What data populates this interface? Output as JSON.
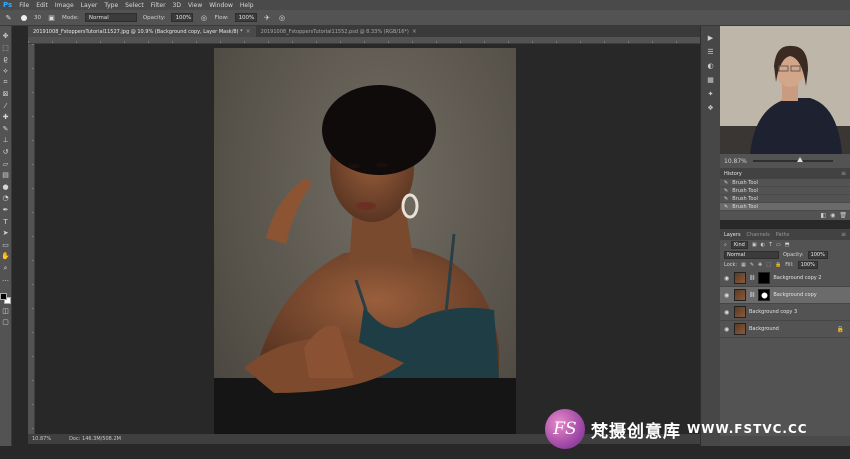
{
  "menubar": {
    "logo": "Ps",
    "items": [
      "File",
      "Edit",
      "Image",
      "Layer",
      "Type",
      "Select",
      "Filter",
      "3D",
      "View",
      "Window",
      "Help"
    ]
  },
  "options": {
    "brush_size": "30",
    "mode_label": "Mode:",
    "mode_value": "Normal",
    "opacity_label": "Opacity:",
    "opacity_value": "100%",
    "flow_label": "Flow:",
    "flow_value": "100%"
  },
  "tabs": [
    {
      "label": "20191008_FstoppersTutorial11527.jpg @ 10.9% (Background copy, Layer Mask/8) *",
      "active": true
    },
    {
      "label": "20191008_FstoppersTutorial11552.psd @ 8.33% (RGB/16*)",
      "active": false
    }
  ],
  "status": {
    "zoom": "10.87%",
    "doc": "Doc: 146.3M/508.2M"
  },
  "navigator": {
    "zoom": "10.87%"
  },
  "history": {
    "title": "History",
    "items": [
      "Brush Tool",
      "Brush Tool",
      "Brush Tool",
      "Brush Tool"
    ]
  },
  "layers_panel": {
    "tabs": [
      "Layers",
      "Channels",
      "Paths"
    ],
    "kind_label": "Kind",
    "blend_mode": "Normal",
    "opacity_label": "Opacity:",
    "opacity_value": "100%",
    "lock_label": "Lock:",
    "fill_label": "Fill:",
    "fill_value": "100%",
    "layers": [
      {
        "name": "Background copy 2",
        "selected": false
      },
      {
        "name": "Background copy",
        "selected": true
      },
      {
        "name": "Background copy 3",
        "selected": false
      },
      {
        "name": "Background",
        "selected": false
      }
    ]
  },
  "watermark": {
    "logo_text": "FS",
    "brand": "梵摄创意库",
    "url": "WWW.FSTVC.CC"
  },
  "colors": {
    "ps_blue": "#31a8ff",
    "panel_bg": "#535353",
    "canvas_bg": "#282828",
    "foreground": "#000000",
    "background": "#ffffff"
  }
}
